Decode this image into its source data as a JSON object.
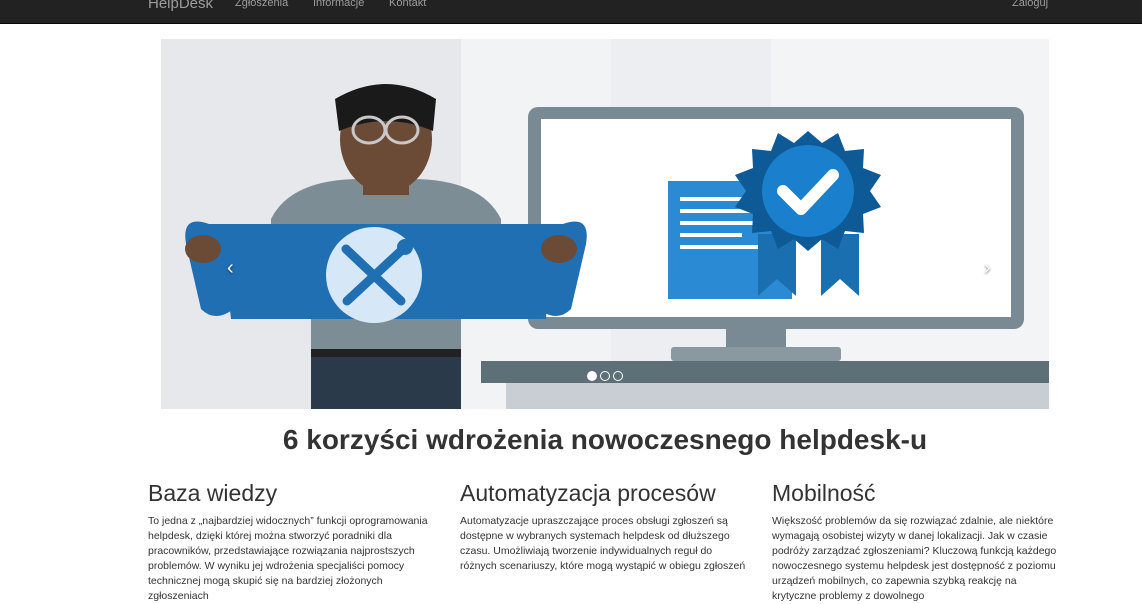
{
  "navbar": {
    "brand": "HelpDesk",
    "links": [
      "Zgłoszenia",
      "Informacje",
      "Kontakt"
    ],
    "login": "Zaloguj"
  },
  "carousel": {
    "prev_icon": "chevron-left-icon",
    "next_icon": "chevron-right-icon",
    "slide_count": 3,
    "active_slide": 1
  },
  "headline": "6 korzyści wdrożenia nowoczesnego helpdesk-u",
  "features": [
    {
      "title": "Baza wiedzy",
      "text": "To jedna z „najbardziej widocznych” funkcji oprogramowania helpdesk, dzięki której można stworzyć poradniki dla pracowników, przedstawiające rozwiązania najprostszych problemów. W wyniku jej wdrożenia specjaliści pomocy technicznej mogą skupić się na bardziej złożonych zgłoszeniach"
    },
    {
      "title": "Automatyzacja procesów",
      "text": "Automatyzacje upraszczające proces obsługi zgłoszeń są dostępne w wybranych systemach helpdesk od dłuższego czasu. Umożliwiają tworzenie indywidualnych reguł do różnych scenariuszy, które mogą wystąpić w obiegu zgłoszeń"
    },
    {
      "title": "Mobilność",
      "text": "Większość problemów da się rozwiązać zdalnie, ale niektóre wymagają osobistej wizyty w danej lokalizacji. Jak w czasie podróży zarządzać zgłoszeniami? Kluczową funkcją każdego nowoczesnego systemu helpdesk jest dostępność z poziomu urządzeń mobilnych, co zapewnia szybką reakcję na krytyczne problemy z dowolnego"
    }
  ]
}
